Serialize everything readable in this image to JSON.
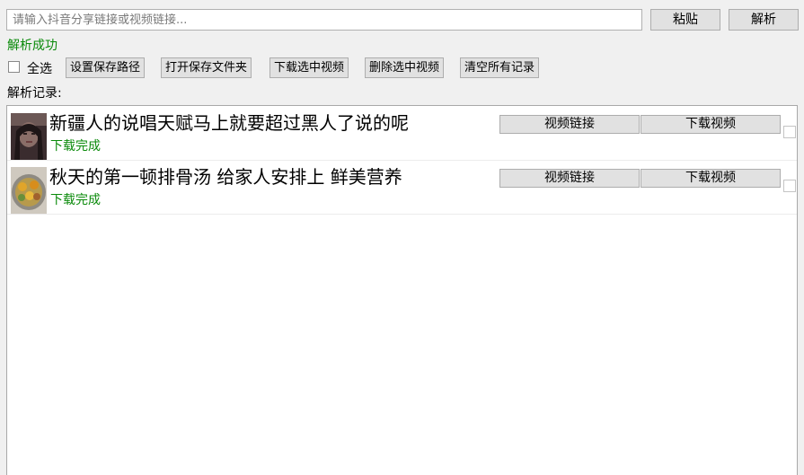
{
  "url_input": {
    "placeholder": "请输入抖音分享链接或视频链接...",
    "value": ""
  },
  "top_buttons": {
    "paste": "粘贴",
    "parse": "解析"
  },
  "status_text": "解析成功",
  "toolbar": {
    "select_all": "全选",
    "set_save_path": "设置保存路径",
    "open_save_folder": "打开保存文件夹",
    "download_selected": "下载选中视频",
    "delete_selected": "删除选中视频",
    "clear_all": "清空所有记录"
  },
  "records_label": "解析记录:",
  "records": [
    {
      "title": "新疆人的说唱天赋马上就要超过黑人了说的呢",
      "status": "下载完成",
      "link_button": "视频链接",
      "download_button": "下载视频",
      "checked": false
    },
    {
      "title": "秋天的第一顿排骨汤 给家人安排上 鲜美营养",
      "status": "下载完成",
      "link_button": "视频链接",
      "download_button": "下载视频",
      "checked": false
    }
  ],
  "colors": {
    "success": "#0a8a0a",
    "button_bg": "#e1e1e1",
    "window_bg": "#f0f0f0"
  }
}
